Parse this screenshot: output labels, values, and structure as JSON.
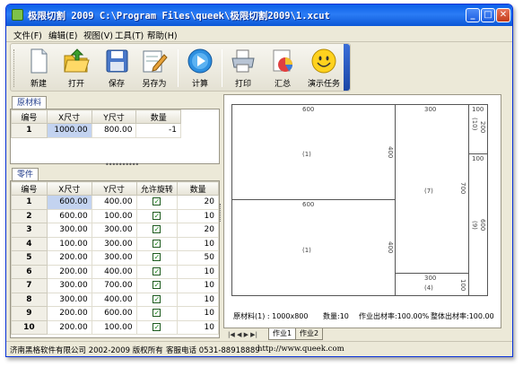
{
  "window": {
    "title": "极限切割 2009 C:\\Program Files\\queek\\极限切割2009\\1.xcut"
  },
  "menu": [
    "文件(F)",
    "编辑(E)",
    "视图(V)",
    "工具(T)",
    "帮助(H)"
  ],
  "toolbar": {
    "new": "新建",
    "open": "打开",
    "save": "保存",
    "save_as": "另存为",
    "calculate": "计算",
    "print": "打印",
    "summary": "汇总",
    "demo": "演示任务"
  },
  "raw_panel": {
    "tab": "原材料",
    "headers": [
      "编号",
      "X尺寸",
      "Y尺寸",
      "数量"
    ],
    "rows": [
      {
        "id": "1",
        "x": "1000.00",
        "y": "800.00",
        "qty": "-1"
      }
    ]
  },
  "parts_panel": {
    "tab": "零件",
    "headers": [
      "编号",
      "X尺寸",
      "Y尺寸",
      "允许旋转",
      "数量"
    ],
    "rows": [
      {
        "id": "1",
        "x": "600.00",
        "y": "400.00",
        "qty": "20"
      },
      {
        "id": "2",
        "x": "600.00",
        "y": "100.00",
        "qty": "10"
      },
      {
        "id": "3",
        "x": "300.00",
        "y": "300.00",
        "qty": "20"
      },
      {
        "id": "4",
        "x": "100.00",
        "y": "300.00",
        "qty": "10"
      },
      {
        "id": "5",
        "x": "200.00",
        "y": "300.00",
        "qty": "50"
      },
      {
        "id": "6",
        "x": "200.00",
        "y": "400.00",
        "qty": "10"
      },
      {
        "id": "7",
        "x": "300.00",
        "y": "700.00",
        "qty": "10"
      },
      {
        "id": "8",
        "x": "300.00",
        "y": "400.00",
        "qty": "10"
      },
      {
        "id": "9",
        "x": "200.00",
        "y": "600.00",
        "qty": "10"
      },
      {
        "id": "10",
        "x": "200.00",
        "y": "100.00",
        "qty": "10"
      }
    ]
  },
  "layout": {
    "pieces": [
      {
        "top": "600",
        "mid": "(1)",
        "side": "400"
      },
      {
        "top": "600",
        "mid": "(1)",
        "side": "400"
      },
      {
        "top": "300",
        "mid": "(7)",
        "side": "700"
      },
      {
        "top": "300",
        "mid": "(4)",
        "side": "100"
      },
      {
        "top": "100",
        "mid": "(10)",
        "side": "200"
      },
      {
        "top": "100",
        "mid": "(9)",
        "side": "600"
      }
    ],
    "summary": {
      "stock": "原材料(1) : 1000x800",
      "qty": "数量:10",
      "yield_job": "作业出材率:100.00%",
      "yield_total": "整体出材率:100.00"
    },
    "tabs": [
      "作业1",
      "作业2"
    ],
    "nav": "|◀ ◀ ▶ ▶|"
  },
  "status": {
    "company": "济南黑格软件有限公司 2002-2009 版权所有",
    "phone": "客服电话 0531-88918889",
    "url": "http://www.queek.com"
  },
  "colors": {
    "title_blue": "#0a5fe8",
    "selection": "#c3d3f0",
    "check_green": "#1f8a1f"
  },
  "icons": [
    "app-icon",
    "minimize-icon",
    "maximize-icon",
    "close-icon",
    "new-file-icon",
    "open-folder-icon",
    "floppy-save-icon",
    "save-as-icon",
    "play-calculate-icon",
    "printer-icon",
    "pie-summary-icon",
    "smiley-demo-icon",
    "checkbox-checked-icon"
  ]
}
